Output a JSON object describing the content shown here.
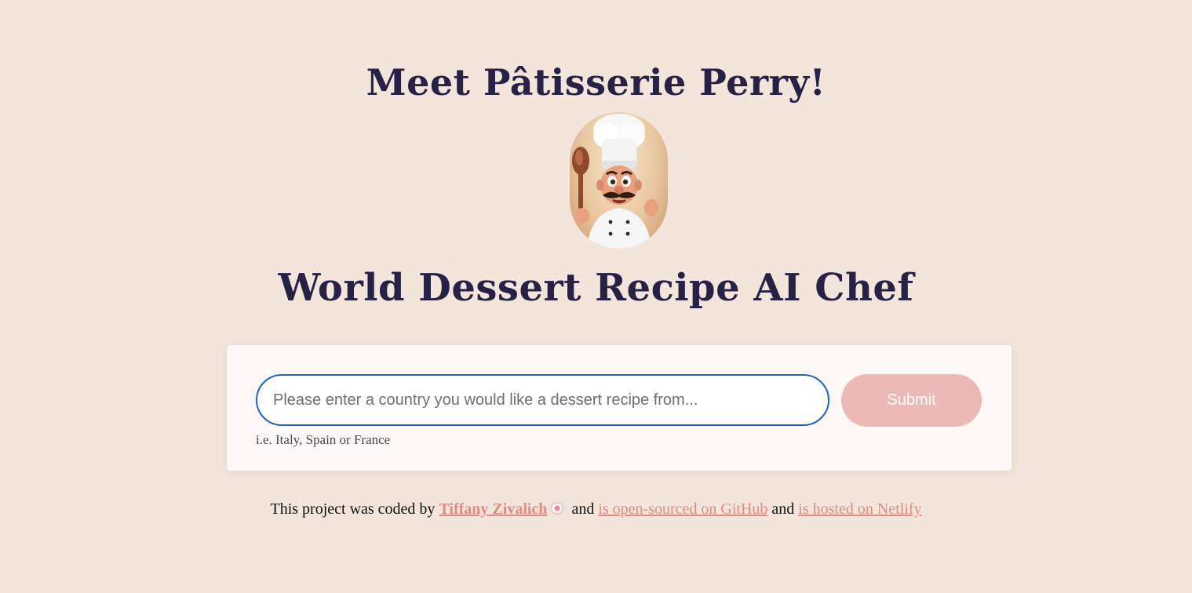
{
  "header": {
    "title": "Meet Pâtisserie Perry!",
    "subtitle": "World Dessert Recipe AI Chef",
    "avatar_icon": "chef-avatar"
  },
  "form": {
    "input_value": "",
    "input_placeholder": "Please enter a country you would like a dessert recipe from...",
    "submit_label": "Submit",
    "hint": "i.e. Italy, Spain or France"
  },
  "footer": {
    "prefix": "This project was coded by ",
    "author_link": "Tiffany Zivalich",
    "emoji": "sushi-emoji",
    "and1": " and ",
    "github_link": "is open-sourced on GitHub",
    "and2": " and ",
    "netlify_link": "is hosted on Netlify"
  },
  "colors": {
    "background": "#f3e5dc",
    "heading": "#262145",
    "input_border": "#1f64c0",
    "button": "#ebbab6",
    "link": "#e08c82"
  }
}
